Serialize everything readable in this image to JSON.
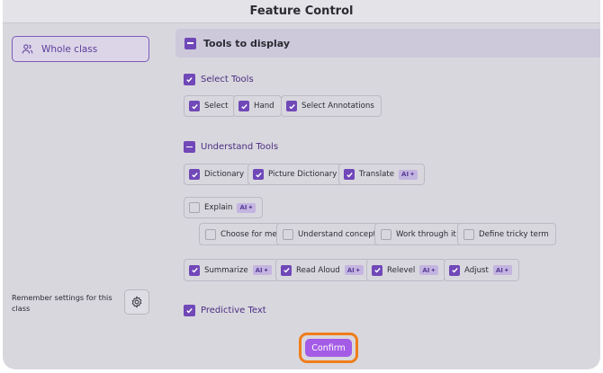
{
  "window": {
    "title": "Feature Control"
  },
  "scope": {
    "label": "Whole class"
  },
  "remember": {
    "label": "Remember settings for this class"
  },
  "tools_section": {
    "title": "Tools to display"
  },
  "select_group": {
    "label": "Select Tools",
    "items": [
      {
        "label": "Select",
        "checked": true
      },
      {
        "label": "Hand",
        "checked": true
      },
      {
        "label": "Select Annotations",
        "checked": true
      }
    ]
  },
  "understand_group": {
    "label": "Understand Tools",
    "items": [
      {
        "label": "Dictionary",
        "checked": true
      },
      {
        "label": "Picture Dictionary",
        "checked": true
      },
      {
        "label": "Translate",
        "checked": true,
        "ai": true
      },
      {
        "label": "Explain",
        "checked": false,
        "ai": true
      }
    ],
    "explain_options": [
      {
        "label": "Choose for me",
        "checked": false
      },
      {
        "label": "Understand concept",
        "checked": false
      },
      {
        "label": "Work through it",
        "checked": false
      },
      {
        "label": "Define tricky term",
        "checked": false
      }
    ],
    "ai_items": [
      {
        "label": "Summarize",
        "checked": true,
        "ai": true
      },
      {
        "label": "Read Aloud",
        "checked": true,
        "ai": true
      },
      {
        "label": "Relevel",
        "checked": true,
        "ai": true
      },
      {
        "label": "Adjust",
        "checked": true,
        "ai": true
      }
    ]
  },
  "predictive": {
    "label": "Predictive Text",
    "checked": true
  },
  "ai_badge": "AI",
  "confirm": {
    "label": "Confirm"
  },
  "colors": {
    "accent": "#7048b8",
    "confirm": "#a45ce6",
    "highlight": "#f07d1a"
  }
}
